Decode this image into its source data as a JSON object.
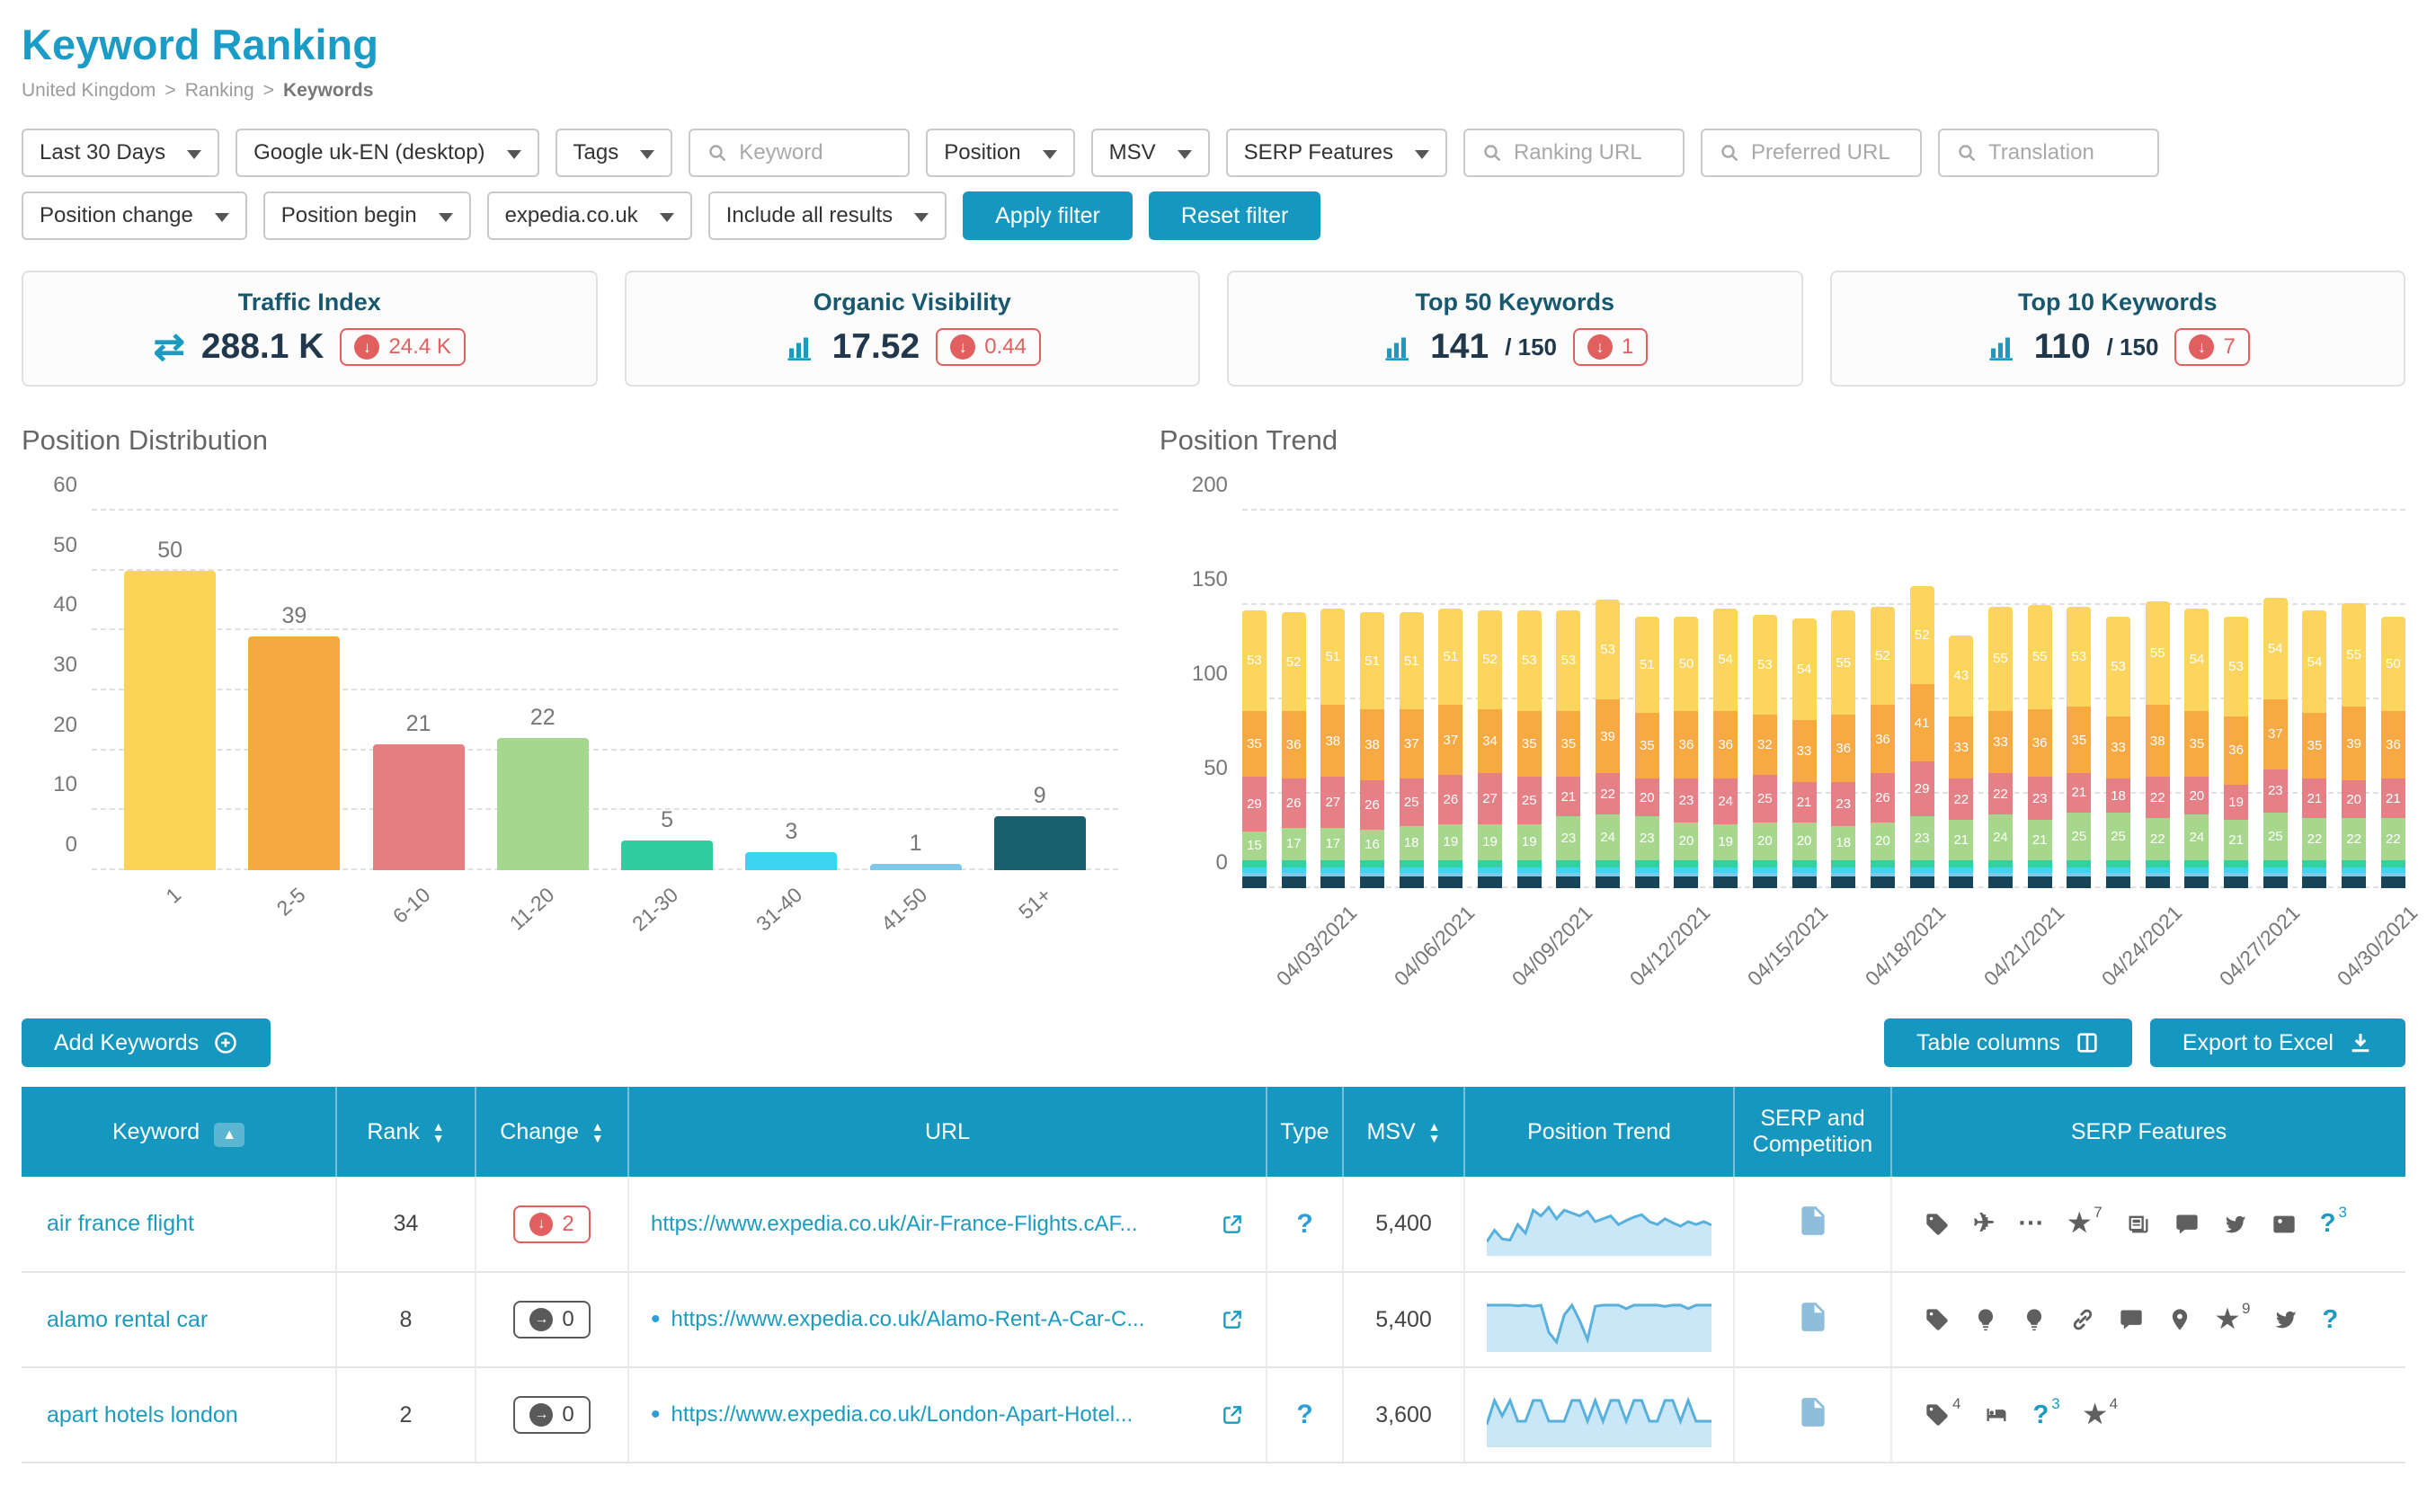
{
  "colors": {
    "accent": "#1697bf",
    "title": "#1b9cc6",
    "negative": "#e25f5f"
  },
  "page": {
    "title": "Keyword Ranking",
    "breadcrumb": [
      "United Kingdom",
      "Ranking",
      "Keywords"
    ],
    "breadcrumb_separator": ">"
  },
  "filters": {
    "row1": [
      {
        "type": "dropdown",
        "label": "Last 30 Days"
      },
      {
        "type": "dropdown",
        "label": "Google uk-EN (desktop)"
      },
      {
        "type": "dropdown",
        "label": "Tags"
      },
      {
        "type": "search",
        "placeholder": "Keyword"
      },
      {
        "type": "dropdown",
        "label": "Position"
      },
      {
        "type": "dropdown",
        "label": "MSV"
      },
      {
        "type": "dropdown",
        "label": "SERP Features"
      },
      {
        "type": "search",
        "placeholder": "Ranking URL"
      },
      {
        "type": "search",
        "placeholder": "Preferred URL"
      },
      {
        "type": "search",
        "placeholder": "Translation"
      }
    ],
    "row2": [
      {
        "type": "dropdown",
        "label": "Position change"
      },
      {
        "type": "dropdown",
        "label": "Position begin"
      },
      {
        "type": "dropdown",
        "label": "expedia.co.uk"
      },
      {
        "type": "dropdown",
        "label": "Include all results"
      },
      {
        "type": "button",
        "label": "Apply filter"
      },
      {
        "type": "button",
        "label": "Reset filter"
      }
    ]
  },
  "kpis": [
    {
      "title": "Traffic Index",
      "icon": "swap-arrows",
      "value": "288.1 K",
      "total": "",
      "delta": "24.4 K",
      "delta_dir": "down"
    },
    {
      "title": "Organic Visibility",
      "icon": "bar-chart",
      "value": "17.52",
      "total": "",
      "delta": "0.44",
      "delta_dir": "down"
    },
    {
      "title": "Top 50 Keywords",
      "icon": "bar-chart",
      "value": "141",
      "total": "/ 150",
      "delta": "1",
      "delta_dir": "down"
    },
    {
      "title": "Top 10 Keywords",
      "icon": "bar-chart",
      "value": "110",
      "total": "/ 150",
      "delta": "7",
      "delta_dir": "down"
    }
  ],
  "chart_data": [
    {
      "type": "bar",
      "title": "Position Distribution",
      "categories": [
        "1",
        "2-5",
        "6-10",
        "11-20",
        "21-30",
        "31-40",
        "41-50",
        "51+"
      ],
      "values": [
        50,
        39,
        21,
        22,
        5,
        3,
        1,
        9
      ],
      "colors": [
        "#fcd557",
        "#f7a941",
        "#e57f82",
        "#a5d78e",
        "#2fce9f",
        "#3bd5f2",
        "#7ec8ec",
        "#1a5f6e"
      ],
      "ylim": [
        0,
        60
      ],
      "yticks": [
        0,
        10,
        20,
        30,
        40,
        50,
        60
      ],
      "grid": "dashed"
    },
    {
      "type": "stacked-bar",
      "title": "Position Trend",
      "x_labels": [
        "04/03/2021",
        "04/06/2021",
        "04/09/2021",
        "04/12/2021",
        "04/15/2021",
        "04/18/2021",
        "04/21/2021",
        "04/24/2021",
        "04/27/2021",
        "04/30/2021"
      ],
      "label_every": 3,
      "ylim": [
        0,
        200
      ],
      "yticks": [
        0,
        50,
        100,
        150,
        200
      ],
      "grid": "dashed",
      "series": [
        {
          "name": "1",
          "color": "#fbd55e",
          "values": [
            53,
            52,
            51,
            51,
            51,
            51,
            52,
            53,
            53,
            53,
            51,
            50,
            54,
            53,
            54,
            55,
            52,
            52,
            43,
            55,
            55,
            53,
            53,
            55,
            54,
            53,
            54,
            54,
            55,
            50
          ]
        },
        {
          "name": "2-5",
          "color": "#f7a943",
          "values": [
            35,
            36,
            38,
            38,
            37,
            37,
            34,
            35,
            35,
            39,
            35,
            36,
            36,
            32,
            33,
            36,
            36,
            41,
            33,
            33,
            36,
            35,
            33,
            38,
            35,
            36,
            37,
            35,
            39,
            36
          ]
        },
        {
          "name": "6-10",
          "color": "#e58087",
          "values": [
            29,
            26,
            27,
            26,
            25,
            26,
            27,
            25,
            21,
            22,
            20,
            23,
            24,
            25,
            21,
            23,
            26,
            29,
            22,
            22,
            23,
            21,
            18,
            22,
            20,
            19,
            23,
            21,
            20,
            21
          ]
        },
        {
          "name": "11-20",
          "color": "#a6d78d",
          "values": [
            15,
            17,
            17,
            16,
            18,
            19,
            19,
            19,
            23,
            24,
            23,
            20,
            19,
            20,
            20,
            18,
            20,
            23,
            21,
            24,
            21,
            25,
            25,
            22,
            24,
            21,
            25,
            22,
            22,
            22
          ]
        },
        {
          "name": "21-30",
          "color": "#35cfa0",
          "values": [
            4,
            4,
            4,
            4,
            4,
            4,
            4,
            4,
            4,
            4,
            4,
            4,
            4,
            4,
            4,
            4,
            4,
            4,
            4,
            4,
            4,
            4,
            4,
            4,
            4,
            4,
            4,
            4,
            4,
            4
          ]
        },
        {
          "name": "31-40",
          "color": "#3ed5f2",
          "values": [
            3,
            3,
            3,
            3,
            3,
            3,
            3,
            3,
            3,
            3,
            3,
            3,
            3,
            3,
            3,
            3,
            3,
            3,
            3,
            3,
            3,
            3,
            3,
            3,
            3,
            3,
            3,
            3,
            3,
            3
          ]
        },
        {
          "name": "41-50",
          "color": "#7ec8ec",
          "values": [
            2,
            2,
            2,
            2,
            2,
            2,
            2,
            2,
            2,
            2,
            2,
            2,
            2,
            2,
            2,
            2,
            2,
            2,
            2,
            2,
            2,
            2,
            2,
            2,
            2,
            2,
            2,
            2,
            2,
            2
          ]
        },
        {
          "name": "51+",
          "color": "#16455a",
          "values": [
            6,
            6,
            6,
            6,
            6,
            6,
            6,
            6,
            6,
            6,
            6,
            6,
            6,
            6,
            6,
            6,
            6,
            6,
            6,
            6,
            6,
            6,
            6,
            6,
            6,
            6,
            6,
            6,
            6,
            6
          ]
        }
      ]
    }
  ],
  "actions": {
    "add_keywords": "Add Keywords",
    "table_columns": "Table columns",
    "export_excel": "Export to Excel"
  },
  "table": {
    "headers": [
      {
        "label": "Keyword",
        "sort": "asc"
      },
      {
        "label": "Rank",
        "sort": "both"
      },
      {
        "label": "Change",
        "sort": "both"
      },
      {
        "label": "URL",
        "sort": ""
      },
      {
        "label": "Type",
        "sort": ""
      },
      {
        "label": "MSV",
        "sort": "both"
      },
      {
        "label": "Position Trend",
        "sort": ""
      },
      {
        "label": "SERP and Competition",
        "sort": ""
      },
      {
        "label": "SERP Features",
        "sort": ""
      }
    ],
    "rows": [
      {
        "keyword": "air france flight",
        "rank": "34",
        "change": "2",
        "change_dir": "down",
        "url": "https://www.expedia.co.uk/Air-France-Flights.cAF...",
        "url_bullet": false,
        "type": "?",
        "msv": "5,400",
        "sparkline": [
          15,
          35,
          20,
          18,
          45,
          30,
          70,
          60,
          75,
          55,
          70,
          65,
          60,
          68,
          50,
          55,
          60,
          45,
          52,
          58,
          62,
          50,
          45,
          55,
          48,
          42,
          50,
          45,
          50,
          44
        ],
        "serp_features": [
          {
            "icon": "tag",
            "sup": "",
            "accent": false
          },
          {
            "icon": "plane",
            "sup": "",
            "accent": false
          },
          {
            "icon": "ellipsis",
            "sup": "",
            "accent": false
          },
          {
            "icon": "star",
            "sup": "7",
            "accent": false
          },
          {
            "icon": "news",
            "sup": "",
            "accent": false
          },
          {
            "icon": "chat",
            "sup": "",
            "accent": false
          },
          {
            "icon": "twitter",
            "sup": "",
            "accent": false
          },
          {
            "icon": "image",
            "sup": "",
            "accent": false
          },
          {
            "icon": "question",
            "sup": "3",
            "accent": true
          }
        ]
      },
      {
        "keyword": "alamo rental car",
        "rank": "8",
        "change": "0",
        "change_dir": "none",
        "url": "https://www.expedia.co.uk/Alamo-Rent-A-Car-C...",
        "url_bullet": true,
        "type": "",
        "msv": "5,400",
        "sparkline": [
          72,
          72,
          72,
          72,
          71,
          72,
          70,
          72,
          25,
          8,
          55,
          72,
          45,
          12,
          70,
          72,
          72,
          72,
          66,
          72,
          72,
          72,
          72,
          70,
          72,
          72,
          66,
          72,
          72,
          72
        ],
        "serp_features": [
          {
            "icon": "tag",
            "sup": "",
            "accent": false
          },
          {
            "icon": "lightbulb",
            "sup": "",
            "accent": false
          },
          {
            "icon": "lightbulb",
            "sup": "",
            "accent": false
          },
          {
            "icon": "link",
            "sup": "",
            "accent": false
          },
          {
            "icon": "chat",
            "sup": "",
            "accent": false
          },
          {
            "icon": "map-pin",
            "sup": "",
            "accent": false
          },
          {
            "icon": "star",
            "sup": "9",
            "accent": false
          },
          {
            "icon": "twitter",
            "sup": "",
            "accent": false
          },
          {
            "icon": "question",
            "sup": "",
            "accent": true
          }
        ]
      },
      {
        "keyword": "apart hotels london",
        "rank": "2",
        "change": "0",
        "change_dir": "none",
        "url": "https://www.expedia.co.uk/London-Apart-Hotel...",
        "url_bullet": true,
        "type": "?",
        "msv": "3,600",
        "sparkline": [
          30,
          72,
          45,
          72,
          36,
          36,
          72,
          72,
          36,
          36,
          36,
          72,
          72,
          36,
          72,
          36,
          72,
          72,
          36,
          72,
          72,
          36,
          36,
          72,
          72,
          36,
          72,
          36,
          36,
          36
        ],
        "serp_features": [
          {
            "icon": "tag",
            "sup": "4",
            "accent": false
          },
          {
            "icon": "bed",
            "sup": "",
            "accent": false
          },
          {
            "icon": "question",
            "sup": "3",
            "accent": true
          },
          {
            "icon": "star",
            "sup": "4",
            "accent": false
          }
        ]
      }
    ]
  }
}
